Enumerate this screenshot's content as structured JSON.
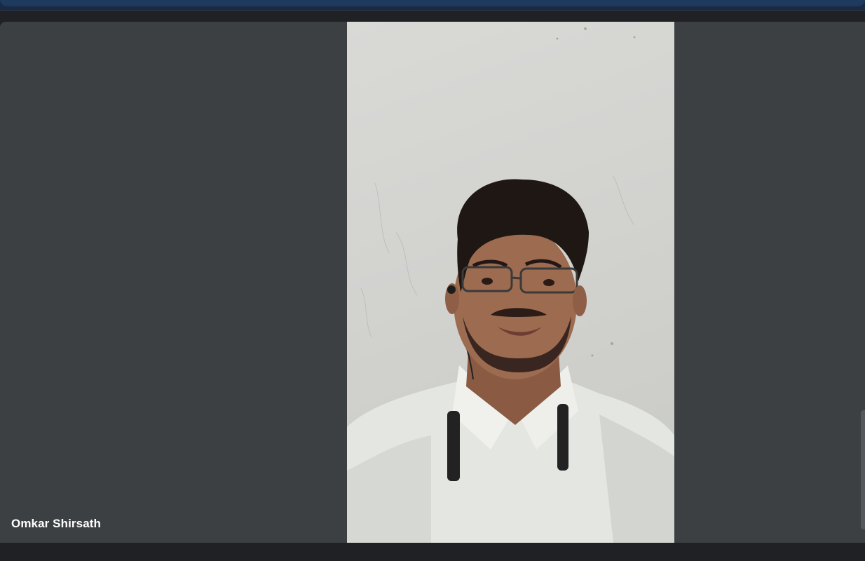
{
  "top_bar": {
    "notice_text": ""
  },
  "participant": {
    "name": "Omkar Shirsath"
  },
  "colors": {
    "stage_background": "#3c4043",
    "page_background": "#202124",
    "name_text": "#ffffff"
  }
}
